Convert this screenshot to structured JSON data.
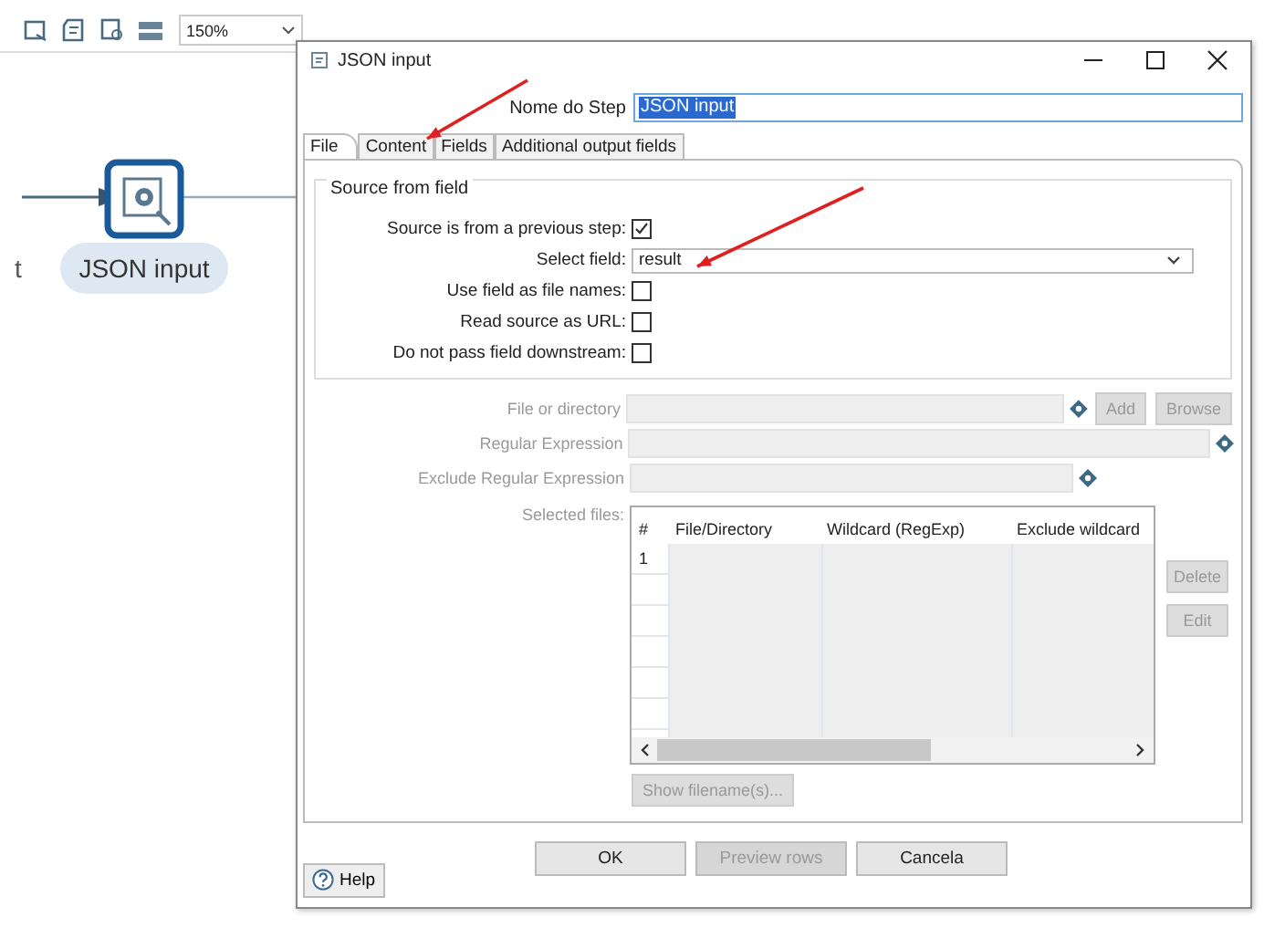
{
  "toolbar": {
    "zoom": "150%"
  },
  "canvas": {
    "cut_label": "t",
    "step": {
      "label": "JSON input"
    }
  },
  "dialog": {
    "title": "JSON input",
    "step_name": {
      "label": "Nome do Step",
      "value": "JSON input"
    },
    "tabs": [
      {
        "label": "File",
        "selected": true
      },
      {
        "label": "Content",
        "selected": false
      },
      {
        "label": "Fields",
        "selected": false
      },
      {
        "label": "Additional output fields",
        "selected": false
      }
    ],
    "source_group": {
      "title": "Source from field",
      "rows": [
        {
          "kind": "checkbox",
          "label": "Source is from a previous step:",
          "checked": true
        },
        {
          "kind": "select",
          "label": "Select field:",
          "value": "result"
        },
        {
          "kind": "checkbox",
          "label": "Use field as file names:",
          "checked": false
        },
        {
          "kind": "checkbox",
          "label": "Read source as URL:",
          "checked": false
        },
        {
          "kind": "checkbox",
          "label": "Do not pass field downstream:",
          "checked": false
        }
      ]
    },
    "file_rows": [
      {
        "label": "File or directory",
        "buttons": [
          "Add",
          "Browse"
        ]
      },
      {
        "label": "Regular Expression",
        "buttons": []
      },
      {
        "label": "Exclude Regular Expression",
        "buttons": []
      }
    ],
    "selected_files": {
      "label": "Selected files:",
      "columns": [
        "#",
        "File/Directory",
        "Wildcard (RegExp)",
        "Exclude wildcard"
      ],
      "row_numbers": [
        "1"
      ],
      "side_buttons": [
        "Delete",
        "Edit"
      ],
      "show_button": "Show filename(s)..."
    },
    "buttons": [
      {
        "label": "OK",
        "disabled": false
      },
      {
        "label": "Preview rows",
        "disabled": true
      },
      {
        "label": "Cancela",
        "disabled": false
      }
    ],
    "help": "Help"
  }
}
